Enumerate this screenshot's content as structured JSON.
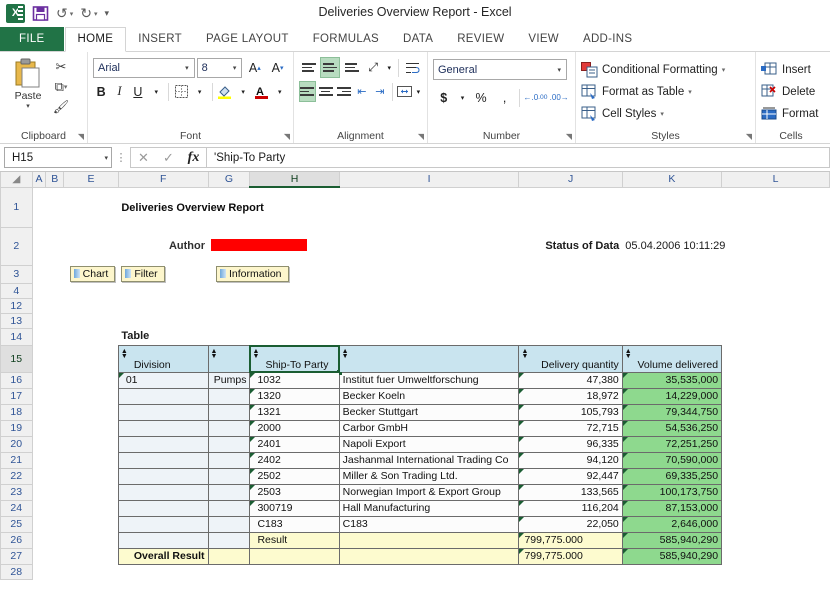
{
  "window": {
    "title": "Deliveries Overview Report - Excel",
    "quick_access": [
      "save",
      "undo",
      "redo",
      "customize"
    ]
  },
  "ribbon": {
    "tabs": [
      {
        "label": "FILE",
        "active": false,
        "file": true
      },
      {
        "label": "HOME",
        "active": true
      },
      {
        "label": "INSERT",
        "active": false
      },
      {
        "label": "PAGE LAYOUT",
        "active": false
      },
      {
        "label": "FORMULAS",
        "active": false
      },
      {
        "label": "DATA",
        "active": false
      },
      {
        "label": "REVIEW",
        "active": false
      },
      {
        "label": "VIEW",
        "active": false
      },
      {
        "label": "ADD-INS",
        "active": false
      }
    ],
    "clipboard": {
      "label": "Clipboard",
      "paste": "Paste"
    },
    "font": {
      "label": "Font",
      "family": "Arial",
      "size": "8",
      "bold": "B",
      "italic": "I",
      "underline": "U"
    },
    "alignment": {
      "label": "Alignment"
    },
    "number": {
      "label": "Number",
      "format": "General",
      "currency": "$",
      "percent": "%",
      "comma": ","
    },
    "styles": {
      "label": "Styles",
      "conditional_formatting": "Conditional Formatting",
      "format_as_table": "Format as Table",
      "cell_styles": "Cell Styles"
    },
    "cells": {
      "label": "Cells",
      "insert": "Insert",
      "delete": "Delete",
      "format": "Format"
    }
  },
  "formula_bar": {
    "name_box": "H15",
    "formula": "'Ship-To Party"
  },
  "grid": {
    "columns": [
      "A",
      "B",
      "E",
      "F",
      "G",
      "H",
      "I",
      "J",
      "K",
      "L"
    ],
    "selected_column": "H",
    "rows": [
      "1",
      "2",
      "3",
      "4",
      "12",
      "13",
      "14",
      "15",
      "16",
      "17",
      "18",
      "19",
      "20",
      "21",
      "22",
      "23",
      "24",
      "25",
      "26",
      "27",
      "28"
    ],
    "selected_row": "15"
  },
  "report": {
    "title": "Deliveries Overview Report",
    "author_label": "Author",
    "author_value": "",
    "status_label": "Status of Data",
    "status_value": "05.04.2006 10:11:29",
    "buttons": [
      "Chart",
      "Filter",
      "Information"
    ],
    "table_title": "Table",
    "headers": [
      "Division",
      "",
      "Ship-To Party",
      "",
      "Delivery quantity",
      "Volume delivered"
    ],
    "rows": [
      {
        "division": "01",
        "division_text": "Pumps",
        "code": "1032",
        "name": "Institut fuer Umweltforschung",
        "qty": "47,380",
        "volume": "35,535,000"
      },
      {
        "division": "",
        "division_text": "",
        "code": "1320",
        "name": "Becker Koeln",
        "qty": "18,972",
        "volume": "14,229,000"
      },
      {
        "division": "",
        "division_text": "",
        "code": "1321",
        "name": "Becker Stuttgart",
        "qty": "105,793",
        "volume": "79,344,750"
      },
      {
        "division": "",
        "division_text": "",
        "code": "2000",
        "name": "Carbor GmbH",
        "qty": "72,715",
        "volume": "54,536,250"
      },
      {
        "division": "",
        "division_text": "",
        "code": "2401",
        "name": "Napoli Export",
        "qty": "96,335",
        "volume": "72,251,250"
      },
      {
        "division": "",
        "division_text": "",
        "code": "2402",
        "name": "Jashanmal International Trading Co",
        "qty": "94,120",
        "volume": "70,590,000"
      },
      {
        "division": "",
        "division_text": "",
        "code": "2502",
        "name": "Miller & Son Trading Ltd.",
        "qty": "92,447",
        "volume": "69,335,250"
      },
      {
        "division": "",
        "division_text": "",
        "code": "2503",
        "name": "Norwegian Import & Export Group",
        "qty": "133,565",
        "volume": "100,173,750"
      },
      {
        "division": "",
        "division_text": "",
        "code": "300719",
        "name": "Hall Manufacturing",
        "qty": "116,204",
        "volume": "87,153,000"
      },
      {
        "division": "",
        "division_text": "",
        "code": "C183",
        "name": "C183",
        "qty": "22,050",
        "volume": "2,646,000"
      }
    ],
    "result_row": {
      "label": "Result",
      "qty": "799,775.000",
      "volume": "585,940,290"
    },
    "overall_row": {
      "label": "Overall Result",
      "qty": "799,775.000",
      "volume": "585,940,290"
    }
  }
}
